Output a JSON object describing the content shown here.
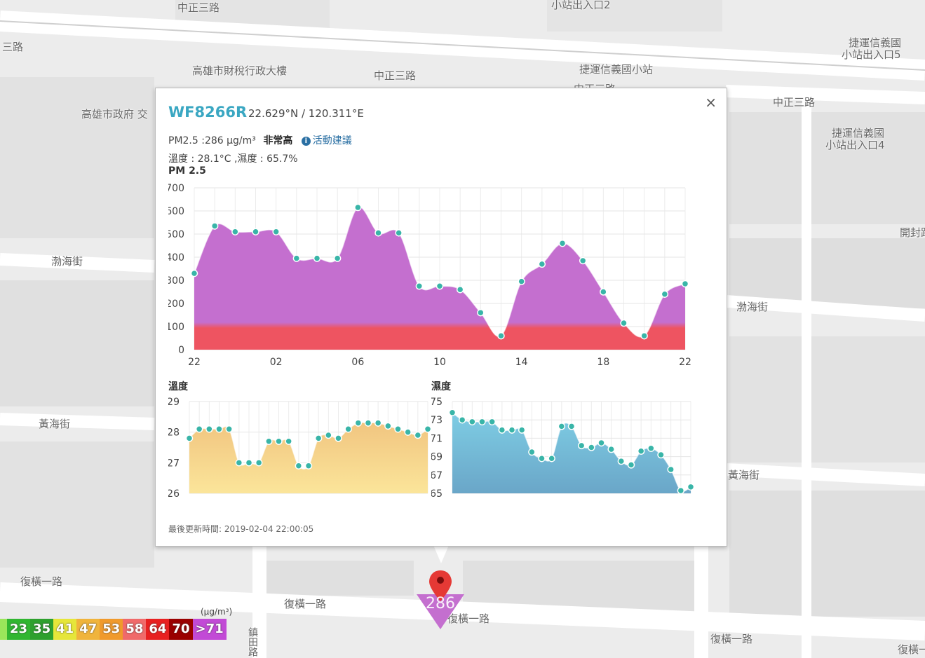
{
  "map": {
    "labels": [
      {
        "text": "中正三路"
      },
      {
        "text": "小站出入口2"
      },
      {
        "text": "三路"
      },
      {
        "text": "高雄市財稅行政大樓"
      },
      {
        "text": "中正三路"
      },
      {
        "text": "捷運信義國小站"
      },
      {
        "text": "捷運信義國"
      },
      {
        "text": "小站出入口5"
      },
      {
        "text": "中正三路"
      },
      {
        "text": "高雄市政府 交"
      },
      {
        "text": "捷運信義國"
      },
      {
        "text": "小站出入口4"
      },
      {
        "text": "渤海街"
      },
      {
        "text": "開封路"
      },
      {
        "text": "渤海街"
      },
      {
        "text": "黃海街"
      },
      {
        "text": "黃海街"
      },
      {
        "text": "復橫一路"
      },
      {
        "text": "復橫一路"
      },
      {
        "text": "復橫一路"
      },
      {
        "text": "復橫一路"
      },
      {
        "text": "復橫一路"
      },
      {
        "text": "鎮田路"
      },
      {
        "text": "中正三路"
      }
    ],
    "marker_value": "286",
    "legend_unit": "(μg/m³)",
    "legend": [
      {
        "label": "",
        "color": "#9ae65a"
      },
      {
        "label": "23",
        "color": "#31b631"
      },
      {
        "label": "35",
        "color": "#2ea02e"
      },
      {
        "label": "41",
        "color": "#e6e63a"
      },
      {
        "label": "47",
        "color": "#f0b43c"
      },
      {
        "label": "53",
        "color": "#f09a2c"
      },
      {
        "label": "58",
        "color": "#f06a6a"
      },
      {
        "label": "64",
        "color": "#e82020"
      },
      {
        "label": "70",
        "color": "#9a0000"
      },
      {
        "label": ">71",
        "color": "#c24ad6"
      }
    ]
  },
  "popup": {
    "close": "×",
    "site_id": "WF8266R",
    "coords": "22.629°N / 120.311°E",
    "pm25_text": "PM2.5 :286 μg/m³",
    "level": "非常高",
    "advice_link": "活動建議",
    "info_icon": "info-icon",
    "temp_humidity": "溫度 : 28.1°C ,濕度 : 65.7%",
    "updated": "最後更新時間: 2019-02-04 22:00:05"
  },
  "chart_data": [
    {
      "type": "area",
      "title": "PM 2.5",
      "ylim": [
        0,
        700
      ],
      "yticks": [
        "0",
        "100",
        "200",
        "300",
        "400",
        "500",
        "600",
        "700"
      ],
      "xticks": [
        "22",
        "02",
        "06",
        "10",
        "14",
        "18",
        "22"
      ],
      "colors": {
        "fill": "#c46fcf",
        "low_band": "#ee5461",
        "point": "#39b5a8"
      },
      "values": [
        330,
        535,
        510,
        510,
        510,
        395,
        395,
        395,
        615,
        505,
        505,
        275,
        275,
        260,
        160,
        60,
        295,
        370,
        460,
        385,
        250,
        115,
        60,
        240,
        285
      ]
    },
    {
      "type": "area",
      "title": "溫度",
      "ylim": [
        26,
        29
      ],
      "yticks": [
        "26",
        "27",
        "28",
        "29"
      ],
      "colors": {
        "fill_top": "#f1c580",
        "fill_bottom": "#fbe59a",
        "point": "#39b5a8"
      },
      "values": [
        27.8,
        28.1,
        28.1,
        28.1,
        28.1,
        27.0,
        27.0,
        27.0,
        27.7,
        27.7,
        27.7,
        26.9,
        26.9,
        27.8,
        27.9,
        27.8,
        28.1,
        28.3,
        28.3,
        28.3,
        28.2,
        28.1,
        28.0,
        27.9,
        28.1
      ]
    },
    {
      "type": "area",
      "title": "濕度",
      "ylim": [
        65,
        75
      ],
      "yticks": [
        "65",
        "67",
        "69",
        "71",
        "73",
        "75"
      ],
      "colors": {
        "fill_top": "#7ecde4",
        "fill_bottom": "#6aa6c8",
        "point": "#39b5a8"
      },
      "values": [
        73.8,
        73.0,
        72.8,
        72.8,
        72.8,
        71.9,
        71.9,
        71.9,
        69.5,
        68.8,
        68.8,
        72.3,
        72.3,
        70.2,
        70.0,
        70.5,
        69.8,
        68.5,
        68.1,
        69.6,
        69.9,
        69.2,
        67.6,
        65.3,
        65.7
      ]
    }
  ]
}
